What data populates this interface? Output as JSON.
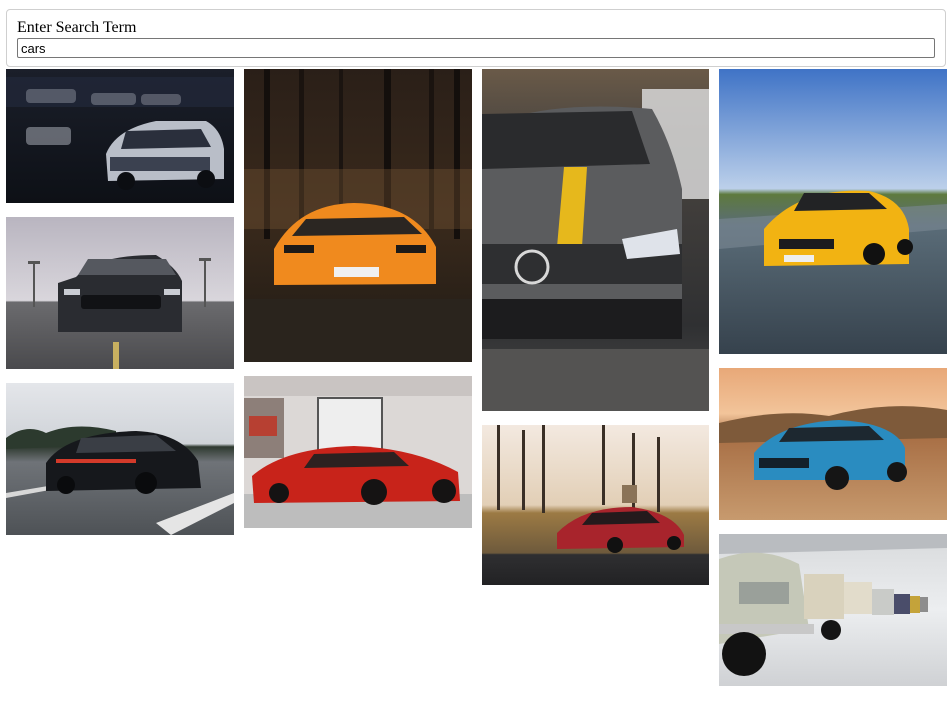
{
  "search": {
    "label": "Enter Search Term",
    "value": "cars"
  },
  "gallery": {
    "images": [
      {
        "name": "silver-camaro-night-garage-photo",
        "depicts": "silver sports car in dark garage"
      },
      {
        "name": "black-mustang-runway-photo",
        "depicts": "black muscle car on road"
      },
      {
        "name": "black-porsche-panamera-highway-photo",
        "depicts": "black sedan driving on highway"
      },
      {
        "name": "orange-lamborghini-forest-photo",
        "depicts": "orange supercar in forest"
      },
      {
        "name": "red-laferrari-showroom-photo",
        "depicts": "red hypercar in showroom"
      },
      {
        "name": "grey-mercedes-yellow-stripe-photo",
        "depicts": "grey car with yellow stripe"
      },
      {
        "name": "red-mercedes-amg-gt-countryside-photo",
        "depicts": "red coupe among pine trees"
      },
      {
        "name": "yellow-mercedes-amg-gt-road-photo",
        "depicts": "yellow coupe on road"
      },
      {
        "name": "blue-camaro-desert-photo",
        "depicts": "blue muscle car in desert"
      },
      {
        "name": "vintage-bmw-row-museum-photo",
        "depicts": "row of classic cars in museum"
      }
    ]
  }
}
